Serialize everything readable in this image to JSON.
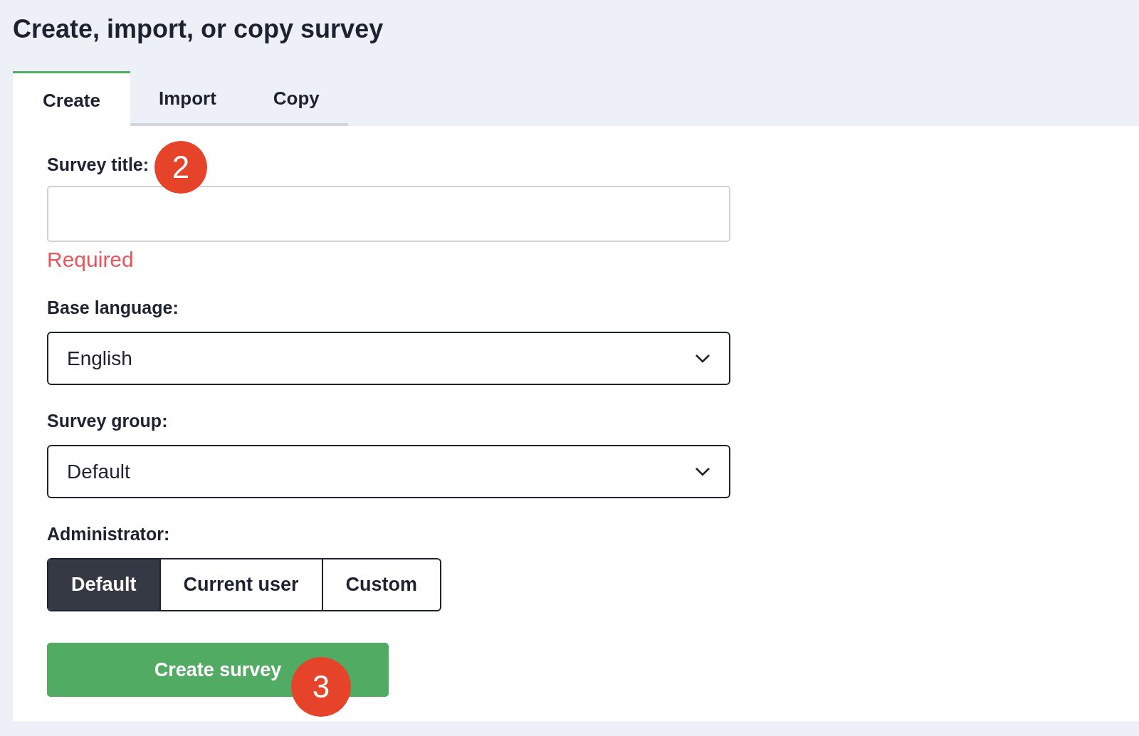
{
  "page_title": "Create, import, or copy survey",
  "tabs": [
    {
      "label": "Create",
      "selected": true
    },
    {
      "label": "Import",
      "selected": false
    },
    {
      "label": "Copy",
      "selected": false
    }
  ],
  "fields": [
    {
      "kind": "text",
      "label": "Survey title:",
      "error": "Required",
      "callout": "2"
    },
    {
      "kind": "select",
      "label": "Base language:",
      "value": "English"
    },
    {
      "kind": "select",
      "label": "Survey group:",
      "value": "Default"
    },
    {
      "kind": "segmented",
      "label": "Administrator:",
      "options": [
        {
          "label": "Default",
          "selected": true
        },
        {
          "label": "Current user",
          "selected": false
        },
        {
          "label": "Custom",
          "selected": false
        }
      ]
    }
  ],
  "submit_button": {
    "label": "Create survey",
    "callout": "3"
  }
}
